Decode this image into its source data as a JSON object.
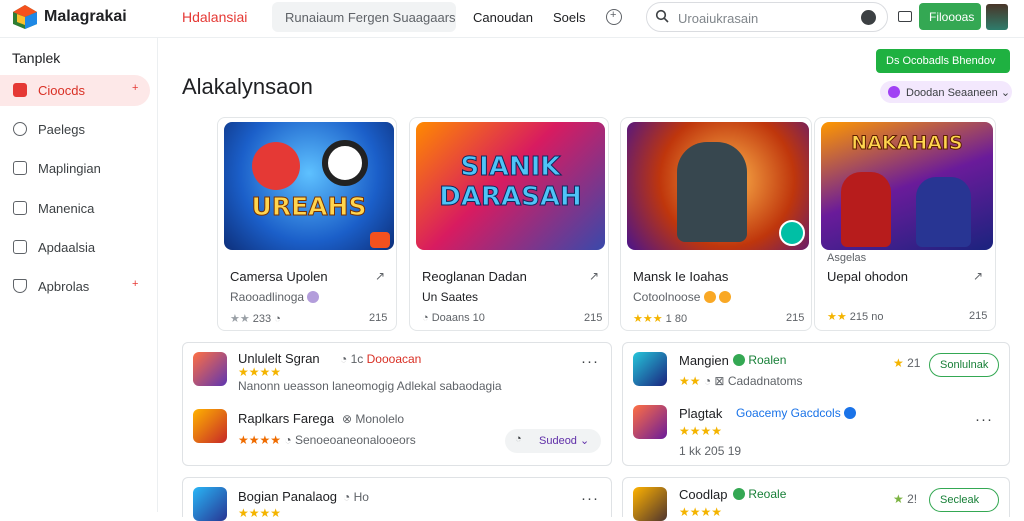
{
  "header": {
    "brand": "Malagrakai",
    "tag": "Hdalansiai",
    "search_chip": "Runaiaum Fergen Suaagaars",
    "links": [
      "Canoudan",
      "Soels"
    ],
    "search_placeholder": "Uroaiukrasain",
    "install_label": "Filoooas"
  },
  "sidebar": {
    "title": "Tanplek",
    "items": [
      {
        "label": "Cioocds",
        "mark": "+"
      },
      {
        "label": "Paelegs"
      },
      {
        "label": "Maplingian"
      },
      {
        "label": "Manenica"
      },
      {
        "label": "Apdaalsia"
      },
      {
        "label": "Apbrolas",
        "mark": "+"
      }
    ]
  },
  "main": {
    "title": "Alakalynsaon",
    "green_button": "Ds Ocobadls Bhendov",
    "pill_label": "Doodan Seaaneen"
  },
  "featured": [
    {
      "thumb_text": "UREAHS",
      "title": "Camersa Upolen",
      "subtitle": "Raooadlinoga",
      "rating": "233",
      "stars_text": "★★",
      "size": "215"
    },
    {
      "thumb_text": "SIANIK DARASAH",
      "title": "Reoglanan Dadan",
      "subtitle": "Un Saates",
      "rating": "Doaans 10",
      "stars_text": "",
      "size": "215"
    },
    {
      "thumb_text": "",
      "title": "Mansk Ie Ioahas",
      "subtitle": "Cotoolnoose",
      "rating": "1 80",
      "stars_text": "★★★",
      "size": "215"
    },
    {
      "thumb_text": "NAKAHAIS",
      "title": "Uepal ohodon",
      "subtitle": "Asgelas",
      "rating": "215 no",
      "stars_text": "★★",
      "size": "215"
    }
  ],
  "list_left": [
    {
      "title": "Unlulelt Sgran",
      "note": "Doooacan",
      "tag": "1c",
      "desc": "Nanonn ueasson laneomogig Adlekal sabaodagia",
      "stars_text": "★★★★"
    },
    {
      "title": "Raplkars Farega",
      "note": "Monolelo",
      "desc": "Senoeoaneonalooeors",
      "stars_text": "★★★★",
      "chip": "Sudeod"
    },
    {
      "title": "Bogian Panalaog",
      "note": "Ho",
      "stars_text": "★★★★"
    }
  ],
  "list_right": [
    {
      "title": "Mangien",
      "note": "Roalen",
      "desc": "Cadadnatoms",
      "stars_text": "★★",
      "score": "21",
      "button": "Sonlulnak"
    },
    {
      "title": "Plagtak",
      "note": "Goacemy Gacdcols",
      "desc": "1 kk 205 19",
      "stars_text": "★★★★"
    },
    {
      "title": "Coodlap",
      "note": "Reoale",
      "stars_text": "★★★★",
      "score": "2!",
      "button": "Secleak"
    }
  ],
  "colors": {
    "accent_red": "#e53935",
    "accent_green": "#34a853",
    "accent_purple": "#a142f4",
    "star": "#f4b400"
  }
}
